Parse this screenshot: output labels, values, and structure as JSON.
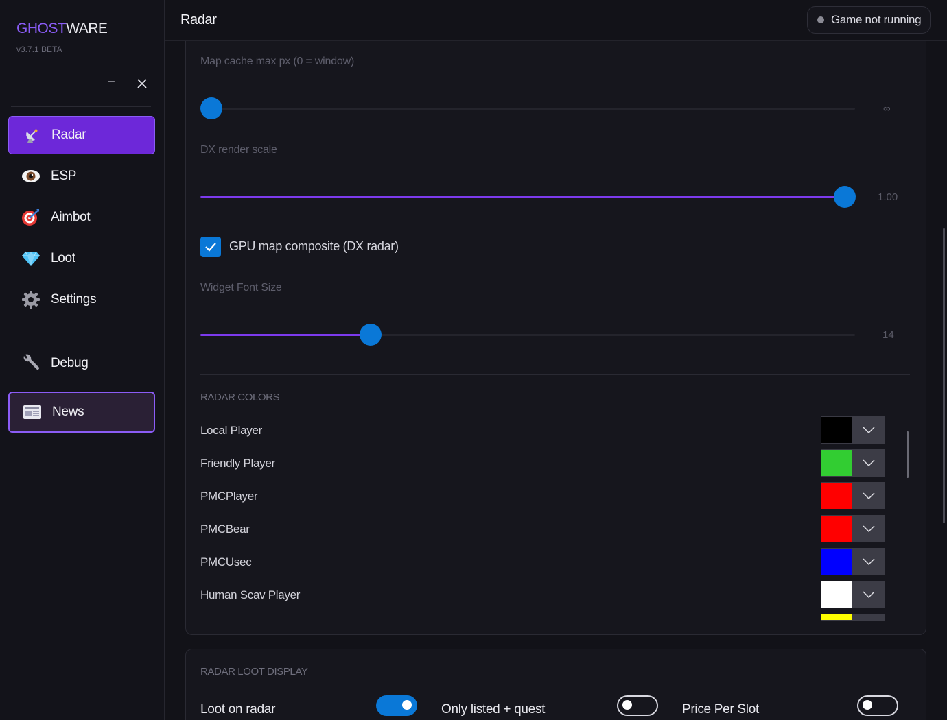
{
  "app": {
    "brand_part1": "GHOST",
    "brand_part2": "WARE",
    "version": "v3.7.1 BETA",
    "minimize_glyph": "–",
    "close_icon": "close-icon"
  },
  "sidebar": {
    "items": [
      {
        "label": "Radar",
        "icon": "radar-dish-icon",
        "state": "active"
      },
      {
        "label": "ESP",
        "icon": "eye-icon",
        "state": "normal"
      },
      {
        "label": "Aimbot",
        "icon": "target-icon",
        "state": "normal"
      },
      {
        "label": "Loot",
        "icon": "diamond-icon",
        "state": "normal"
      },
      {
        "label": "Settings",
        "icon": "gear-icon",
        "state": "normal"
      },
      {
        "label": "Debug",
        "icon": "wrench-icon",
        "state": "normal"
      },
      {
        "label": "News",
        "icon": "newspaper-icon",
        "state": "highlighted"
      }
    ]
  },
  "header": {
    "title": "Radar",
    "status": "Game not running",
    "status_color": "#8a8a94"
  },
  "settings": {
    "map_cache": {
      "label": "Map cache max px (0 = window)",
      "value_text": "∞",
      "value_fraction": 0.0
    },
    "dx_render_scale": {
      "label": "DX render scale",
      "value_text": "1.00",
      "value_fraction": 1.0
    },
    "gpu_composite": {
      "label": "GPU map composite (DX radar)",
      "checked": true
    },
    "widget_font_size": {
      "label": "Widget Font Size",
      "value_text": "14",
      "value_fraction": 0.26
    }
  },
  "radar_colors": {
    "title": "RADAR COLORS",
    "rows": [
      {
        "label": "Local Player",
        "color": "#000000"
      },
      {
        "label": "Friendly Player",
        "color": "#32cd32"
      },
      {
        "label": "PMCPlayer",
        "color": "#ff0000"
      },
      {
        "label": "PMCBear",
        "color": "#ff0000"
      },
      {
        "label": "PMCUsec",
        "color": "#0000ff"
      },
      {
        "label": "Human Scav Player",
        "color": "#ffffff"
      }
    ],
    "partial_next_color": "#ffff00"
  },
  "radar_loot": {
    "title": "RADAR LOOT DISPLAY",
    "toggles": [
      {
        "label": "Loot on radar",
        "on": true
      },
      {
        "label": "Only listed + quest",
        "on": false
      },
      {
        "label": "Price Per Slot",
        "on": false
      }
    ]
  },
  "colors": {
    "accent_purple": "#7c3aed",
    "accent_blue": "#0a78d7",
    "background": "#121218"
  }
}
